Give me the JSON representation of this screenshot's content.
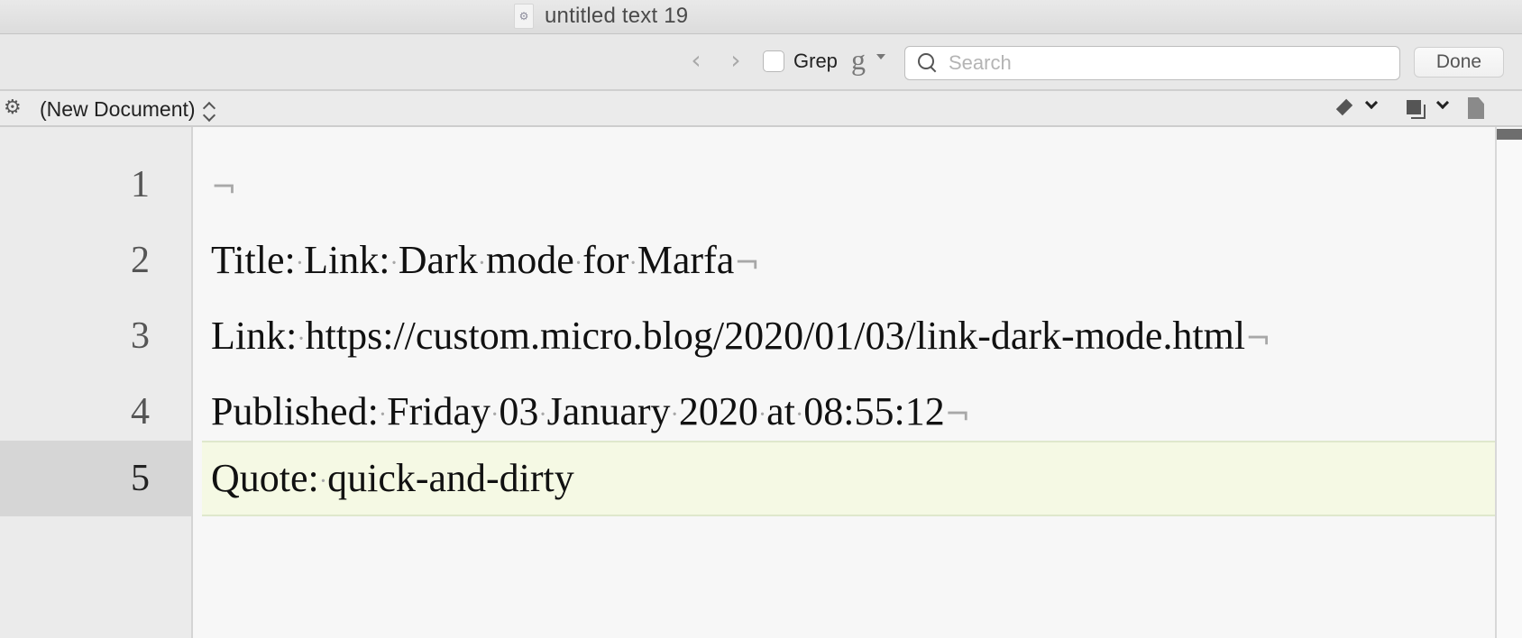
{
  "window": {
    "title": "untitled text 19",
    "document_icon": "bbedit-document-icon"
  },
  "findbar": {
    "prev_icon": "‹",
    "next_icon": "›",
    "grep_label": "Grep",
    "grep_checked": false,
    "grep_options_glyph": "g",
    "search_value": "",
    "search_placeholder": "Search",
    "done_label": "Done"
  },
  "docbar": {
    "gear_glyph": "⚙",
    "document_selector": "(New Document)"
  },
  "editor": {
    "current_line": 5,
    "lines": [
      {
        "number": "1",
        "segments": []
      },
      {
        "number": "2",
        "segments": [
          "Title:",
          "Link:",
          "Dark",
          "mode",
          "for",
          "Marfa"
        ]
      },
      {
        "number": "3",
        "segments": [
          "Link:",
          "https://custom.micro.blog/2020/01/03/link-dark-mode.html"
        ]
      },
      {
        "number": "4",
        "segments": [
          "Published:",
          "Friday",
          "03",
          "January",
          "2020",
          "at",
          "08:55:12"
        ]
      },
      {
        "number": "5",
        "segments": [
          "Quote:",
          "quick-and-dirty"
        ]
      }
    ],
    "invisible_space": "·",
    "invisible_eol": "¬"
  },
  "colors": {
    "current_line_bg": "#f5f9e4",
    "gutter_bg": "#ebebeb",
    "editor_bg": "#f7f7f7"
  }
}
